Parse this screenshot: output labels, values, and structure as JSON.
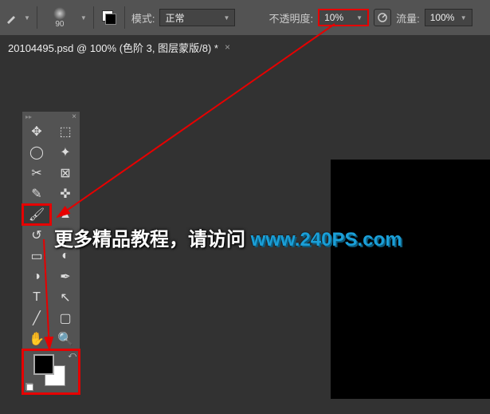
{
  "options": {
    "brush_size": "90",
    "mode_label": "模式:",
    "mode_value": "正常",
    "opacity_label": "不透明度:",
    "opacity_value": "10%",
    "flow_label": "流量:",
    "flow_value": "100%"
  },
  "tab": {
    "title": "20104495.psd @ 100% (色阶 3, 图层蒙版/8) *",
    "close": "×"
  },
  "overlay": {
    "text1": "更多精品教程，请访问 ",
    "text2": "www.240PS.com"
  },
  "tools": {
    "move": "✥",
    "marquee": "⬚",
    "lasso": "◯",
    "wand": "✦",
    "crop": "✂",
    "slice": "⊠",
    "eyedropper": "✎",
    "healing": "✜",
    "brush": "🖌",
    "stamp": "▲",
    "history": "↺",
    "eraser": "◧",
    "gradient": "▭",
    "blur": "◐",
    "dodge": "◑",
    "pen": "✒",
    "type": "T",
    "path": "↖",
    "line": "╱",
    "shape": "▢",
    "hand": "✋",
    "zoom": "🔍"
  }
}
